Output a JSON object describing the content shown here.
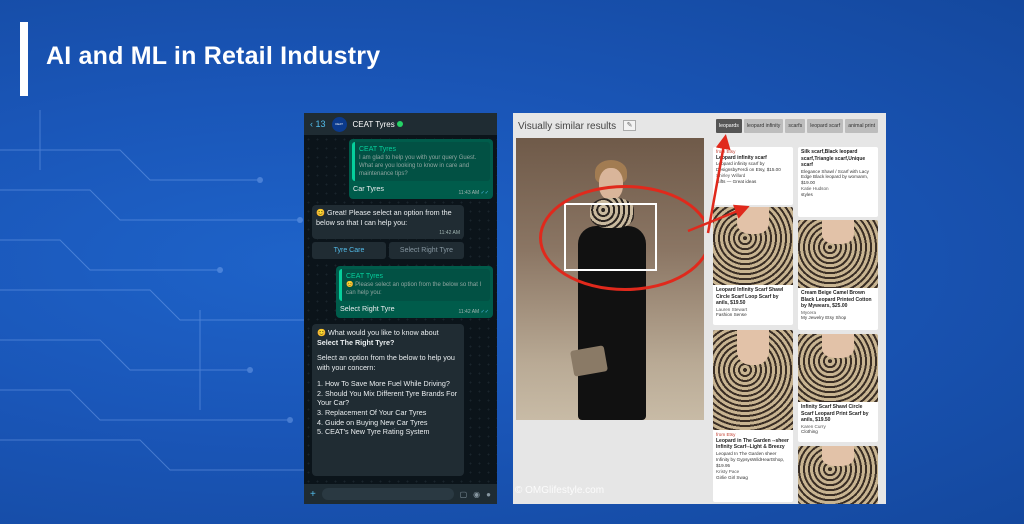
{
  "header": {
    "title": "AI and ML in Retail Industry"
  },
  "chat": {
    "back_count": "13",
    "avatar_text": "CEAT",
    "contact": "CEAT Tyres",
    "quote1_title": "CEAT Tyres",
    "quote1_text": "I am glad to help you with your query Guest. What are you looking to know in care and maintenance tips?",
    "msg1": "Car Tyres",
    "time1": "11:43 AM",
    "msg2": "😊 Great! Please select an option from the below so that I can help you:",
    "time2": "11:42 AM",
    "btn1": "Tyre Care",
    "btn2": "Select Right Tyre",
    "quote2_title": "CEAT Tyres",
    "quote2_text": "😊 Please select an option from the below so that I can help you:",
    "msg3": "Select Right Tyre",
    "time3": "11:42 AM",
    "msg4_intro": "😊 What would you like to know about",
    "msg4_bold": "Select The Right Tyre?",
    "msg4_prompt": "Select an option from the below to help you with your concern:",
    "options": [
      "1. How To Save More Fuel While Driving?",
      "2. Should You Mix Different Tyre Brands For Your Car?",
      "3. Replacement Of Your Car Tyres",
      "4. Guide on Buying New Car Tyres",
      "5. CEAT's New Tyre Rating System"
    ]
  },
  "visual": {
    "title": "Visually similar results",
    "chips": [
      "leopards",
      "leopard infinity",
      "scarfs",
      "leopard scarf",
      "animal print"
    ],
    "watermark": "© OMGlifestyle.com",
    "cards": [
      {
        "src": "from Etsy",
        "title": "Leopard infinity scarf",
        "desc": "Leopard infinity scarf by DesignsbyFerdi on Etsy, $15.00",
        "user": "Shirley Willard",
        "board": "Gifts — Great ideas"
      },
      {
        "src": "",
        "title": "Leopard Infinity Scarf Shawl Circle Scarf Loop Scarf by anils, $19.50",
        "desc": "",
        "user": "Lauren Stewart",
        "board": "Fashion Sense"
      },
      {
        "src": "from Etsy",
        "title": "Leopard in The Garden --sheer Infinity Scarf--Light & Breezy",
        "desc": "Leopard In The Garden sheer Infinity by GypsysWildHeartShop, $19.95",
        "user": "Kristy Pace",
        "board": "Girlie Girl Swag"
      },
      {
        "src": "",
        "title": "Silk scarf,Black leopard scarf,Triangle scarf,Unique scarf",
        "desc": "Elegance Shawl / Scarf with Lacy Edge Black leopard by womanm, $19.00",
        "user": "Katie Hudson",
        "board": "styles"
      },
      {
        "src": "",
        "title": "Cream Beige Camel Brown Black Leopard Printed Cotton by Mywears, $25.00",
        "desc": "",
        "user": "Mycera",
        "board": "My Jewelry Etsy Shop"
      },
      {
        "src": "",
        "title": "Infinity Scarf Shawl Circle Scarf Leopard Print Scarf by anils, $19.50",
        "desc": "",
        "user": "Karen Curry",
        "board": "Clothing"
      }
    ]
  }
}
